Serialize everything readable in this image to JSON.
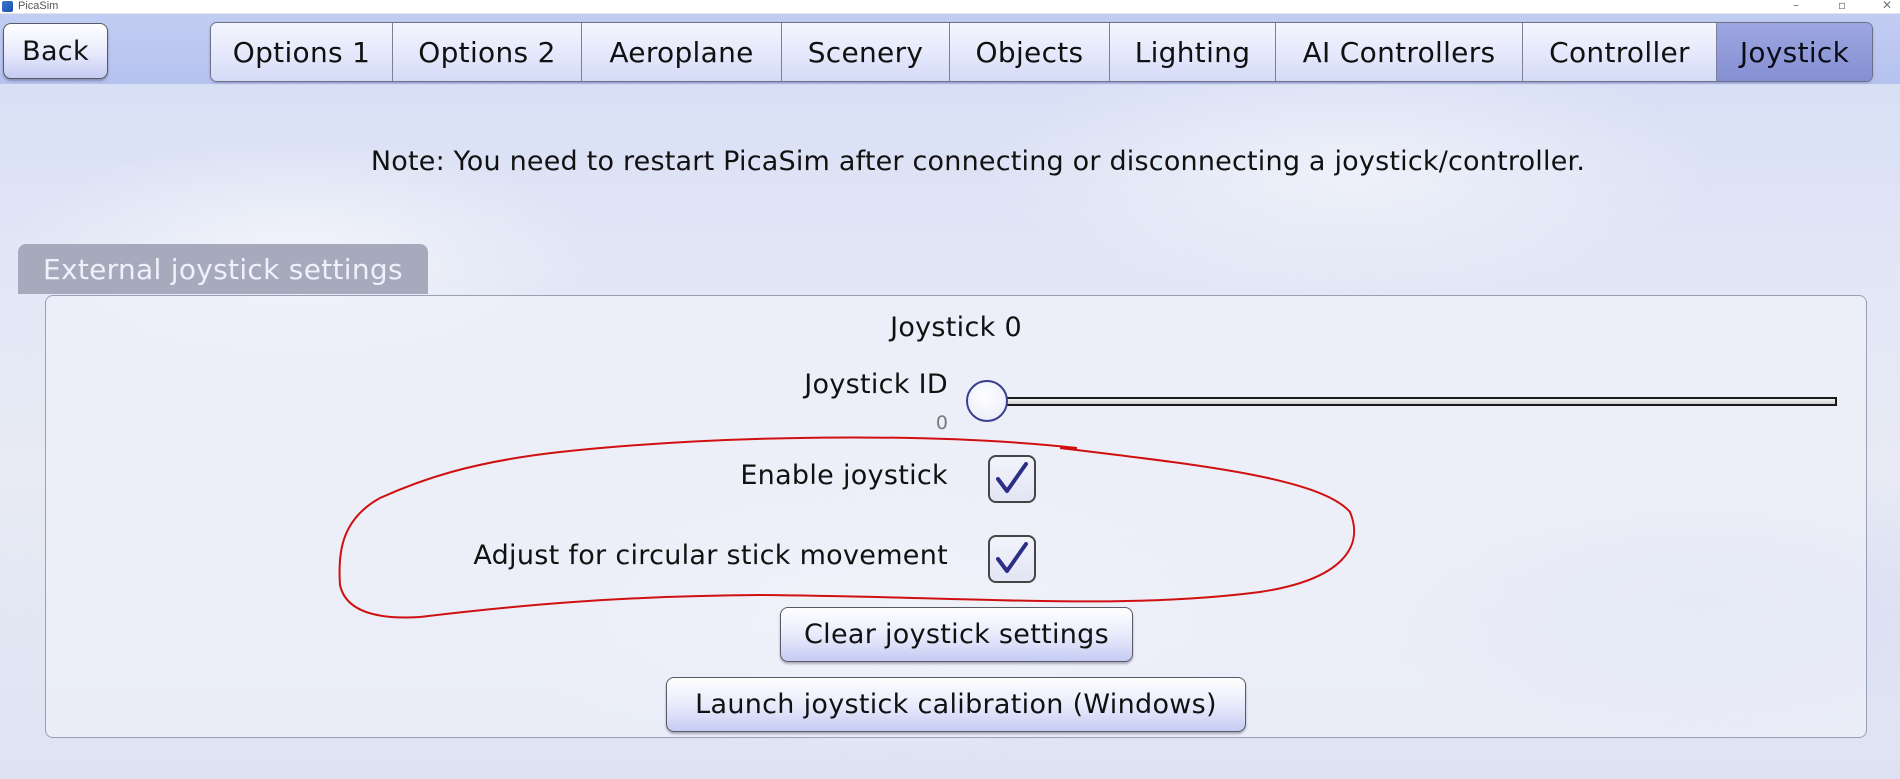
{
  "window": {
    "title": "PicaSim",
    "controls": {
      "minimize": "–",
      "maximize": "▫",
      "close": "✕"
    }
  },
  "back_button": {
    "label": "Back"
  },
  "tabs": [
    {
      "label": "Options 1",
      "active": false
    },
    {
      "label": "Options 2",
      "active": false
    },
    {
      "label": "Aeroplane",
      "active": false
    },
    {
      "label": "Scenery",
      "active": false
    },
    {
      "label": "Objects",
      "active": false
    },
    {
      "label": "Lighting",
      "active": false
    },
    {
      "label": "AI Controllers",
      "active": false
    },
    {
      "label": "Controller",
      "active": false
    },
    {
      "label": "Joystick",
      "active": true
    }
  ],
  "note": "Note: You need to restart PicaSim after connecting or disconnecting a joystick/controller.",
  "section": {
    "title": "External joystick settings",
    "joystick_heading": "Joystick 0",
    "joystick_id": {
      "label": "Joystick ID",
      "value": "0",
      "slider_fraction": 0.0
    },
    "enable_joystick": {
      "label": "Enable joystick",
      "checked": true
    },
    "circular_adjust": {
      "label": "Adjust for circular stick movement",
      "checked": true
    },
    "clear_button": {
      "label": "Clear joystick settings"
    },
    "calibrate_button": {
      "label": "Launch joystick calibration (Windows)"
    }
  },
  "colors": {
    "active_tab": "#8590d3",
    "checkmark": "#2b2f86",
    "annotation": "#d01010"
  },
  "icons": {
    "checkbox_check": "checkmark-icon",
    "app": "picasim-icon"
  }
}
